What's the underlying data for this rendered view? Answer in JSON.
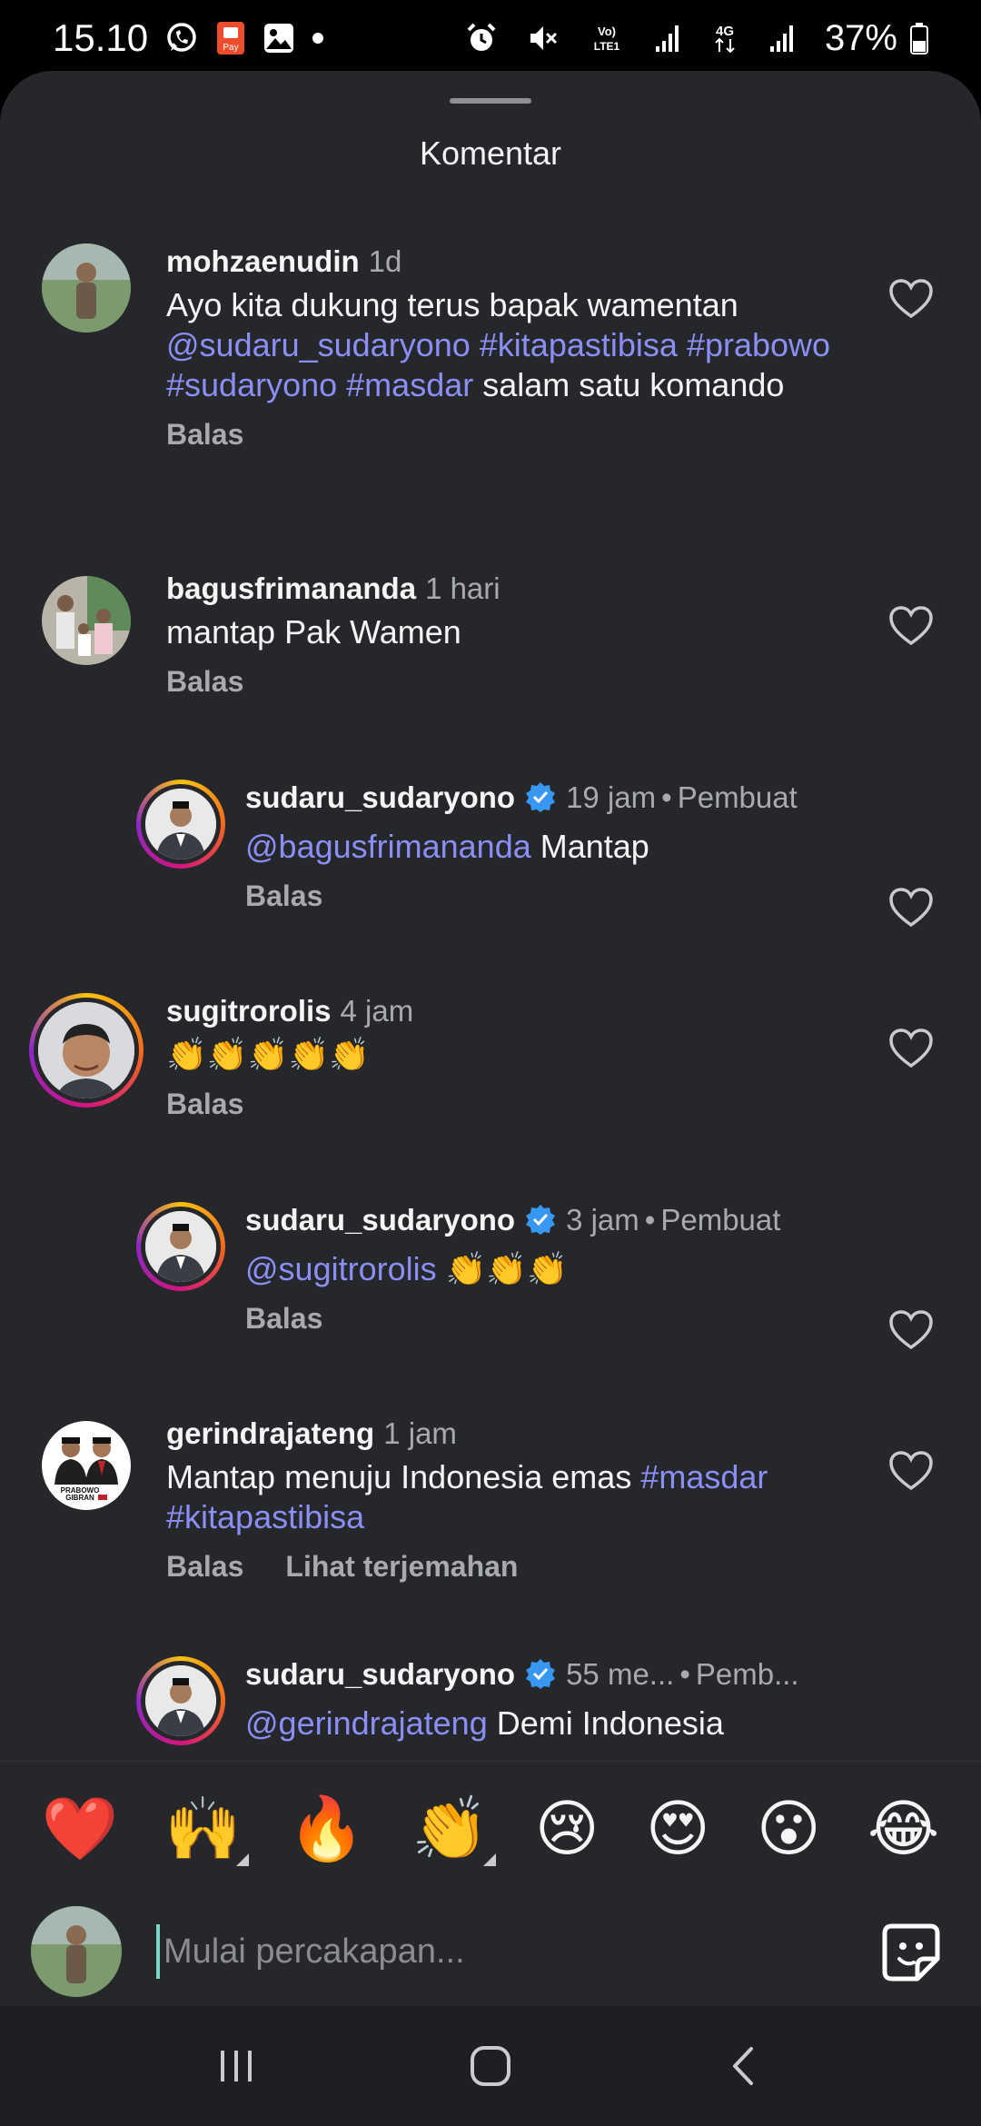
{
  "status_bar": {
    "time": "15.10",
    "notification_icons": [
      "whatsapp-icon",
      "shopeepay-icon",
      "gallery-icon",
      "dot-icon"
    ],
    "system_icons": [
      "alarm-icon",
      "mute-icon",
      "volte-icon",
      "signal-icon",
      "4g-icon",
      "signal-icon",
      "battery-icon"
    ],
    "volte_label": "Vo) LTE1",
    "network_label": "4G",
    "battery": "37%"
  },
  "sheet": {
    "title": "Komentar"
  },
  "comments": [
    {
      "user": "mohzaenudin",
      "time": "1d",
      "verified": false,
      "creator": "",
      "text_segments": [
        {
          "t": "Ayo kita dukung terus bapak wamentan ",
          "tag": false
        },
        {
          "t": "@sudaru_sudaryono",
          "tag": true
        },
        {
          "t": " ",
          "tag": false
        },
        {
          "t": "#kitapastibisa",
          "tag": true
        },
        {
          "t": " ",
          "tag": false
        },
        {
          "t": "#prabowo",
          "tag": true
        },
        {
          "t": " ",
          "tag": false
        },
        {
          "t": "#sudaryono",
          "tag": true
        },
        {
          "t": " ",
          "tag": false
        },
        {
          "t": "#masdar",
          "tag": true
        },
        {
          "t": " salam satu komando",
          "tag": false
        }
      ],
      "reply_label": "Balas"
    },
    {
      "user": "bagusfrimananda",
      "time": "1 hari",
      "verified": false,
      "creator": "",
      "text_segments": [
        {
          "t": "mantap Pak Wamen",
          "tag": false
        }
      ],
      "reply_label": "Balas"
    },
    {
      "user": "sudaru_sudaryono",
      "time": "19 jam",
      "verified": true,
      "creator": "Pembuat",
      "text_segments": [
        {
          "t": "@bagusfrimananda",
          "tag": true
        },
        {
          "t": " Mantap",
          "tag": false
        }
      ],
      "reply_label": "Balas"
    },
    {
      "user": "sugitrorolis",
      "time": "4 jam",
      "verified": false,
      "creator": "",
      "text_segments": [
        {
          "t": "👏👏👏👏👏",
          "tag": false
        }
      ],
      "reply_label": "Balas"
    },
    {
      "user": "sudaru_sudaryono",
      "time": "3 jam",
      "verified": true,
      "creator": "Pembuat",
      "text_segments": [
        {
          "t": "@sugitrorolis",
          "tag": true
        },
        {
          "t": " 👏👏👏",
          "tag": false
        }
      ],
      "reply_label": "Balas"
    },
    {
      "user": "gerindrajateng",
      "time": "1 jam",
      "verified": false,
      "creator": "",
      "text_segments": [
        {
          "t": "Mantap menuju Indonesia emas ",
          "tag": false
        },
        {
          "t": "#masdar",
          "tag": true
        },
        {
          "t": " ",
          "tag": false
        },
        {
          "t": "#kitapastibisa",
          "tag": true
        }
      ],
      "reply_label": "Balas",
      "translate_label": "Lihat terjemahan",
      "avatar_text": "PRABOWO GIBRAN"
    },
    {
      "user": "sudaru_sudaryono",
      "time": "55 me...",
      "verified": true,
      "creator": "Pemb...",
      "text_segments": [
        {
          "t": "@gerindrajateng",
          "tag": true
        },
        {
          "t": " Demi Indonesia",
          "tag": false
        }
      ],
      "reply_label": ""
    }
  ],
  "reactions": [
    {
      "emoji": "❤️",
      "name": "heart"
    },
    {
      "emoji": "🙌",
      "name": "raising-hands",
      "more": true
    },
    {
      "emoji": "🔥",
      "name": "fire"
    },
    {
      "emoji": "👏",
      "name": "clapping-hands",
      "more": true
    },
    {
      "emoji": "😢",
      "name": "crying-face"
    },
    {
      "emoji": "😍",
      "name": "heart-eyes"
    },
    {
      "emoji": "😮",
      "name": "surprised-face"
    },
    {
      "emoji": "😂",
      "name": "laughing-face"
    }
  ],
  "composer": {
    "placeholder": "Mulai percakapan..."
  },
  "nav_bar": {
    "buttons": [
      "recent-apps",
      "home",
      "back"
    ]
  },
  "colors": {
    "sheet_bg": "#25272b",
    "tag": "#8b8ff5",
    "muted": "#a8aab0",
    "verified": "#3897f0"
  }
}
